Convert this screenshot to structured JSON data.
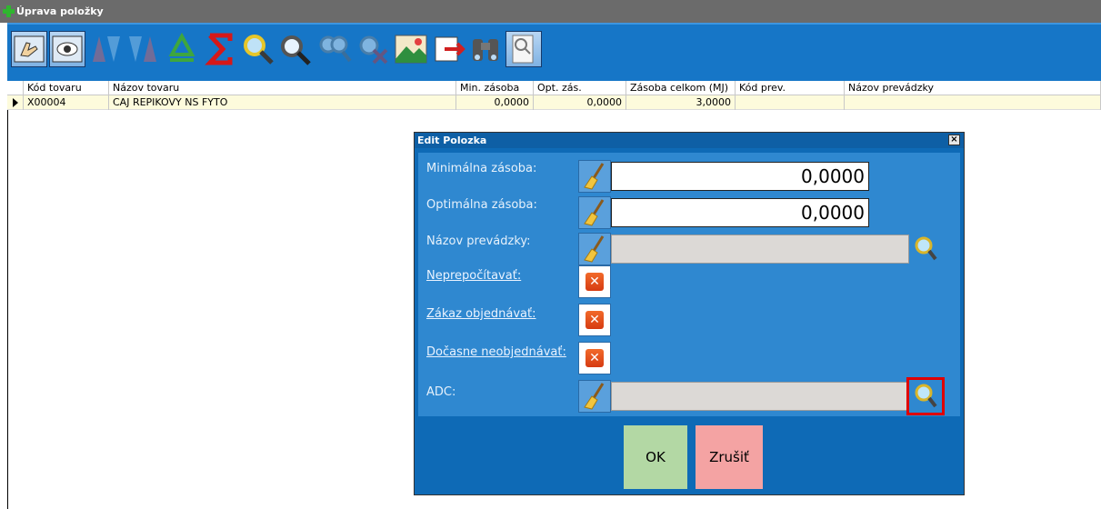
{
  "window": {
    "title": "Úprava položky"
  },
  "toolbar": {
    "buttons": [
      {
        "icon": "edit-hand-icon"
      },
      {
        "icon": "view-eye-icon"
      },
      {
        "icon": "sort-asc-icon"
      },
      {
        "icon": "sort-desc-icon"
      },
      {
        "icon": "recycle-icon"
      },
      {
        "icon": "sum-icon"
      },
      {
        "icon": "search-icon"
      },
      {
        "icon": "search-zoom-icon"
      },
      {
        "icon": "multi-search-icon"
      },
      {
        "icon": "cancel-search-icon"
      },
      {
        "icon": "image-icon"
      },
      {
        "icon": "export-icon"
      },
      {
        "icon": "binoculars-icon"
      },
      {
        "icon": "document-search-icon"
      }
    ]
  },
  "grid": {
    "columns": [
      "Kód tovaru",
      "Názov tovaru",
      "Min. zásoba",
      "Opt. zás.",
      "Zásoba celkom (MJ)",
      "Kód prev.",
      "Názov prevádzky"
    ],
    "rows": [
      {
        "kod": "X00004",
        "nazov": "CAJ REPIKOVY NS  FYTO",
        "min": "0,0000",
        "opt": "0,0000",
        "zasoba": "3,0000",
        "kod_prev": "",
        "nazov_prev": ""
      }
    ]
  },
  "dialog": {
    "title": "Edit Polozka",
    "close_label": "×",
    "fields": {
      "min_label": "Minimálna zásoba:",
      "min_value": "0,0000",
      "opt_label": "Optimálna zásoba:",
      "opt_value": "0,0000",
      "prev_label": "Názov prevádzky:",
      "prev_value": "",
      "neprep_label": "Neprepočítavať:",
      "zakaz_label": "Zákaz objednávať:",
      "docasne_label": "Dočasne neobjednávať:",
      "adc_label": "ADC:",
      "adc_value": ""
    },
    "checkbox_glyph": "✕",
    "ok_label": "OK",
    "cancel_label": "Zrušiť"
  },
  "colors": {
    "toolbar": "#1676c7",
    "dialog_body": "#2f88d0",
    "ok": "#b3d8a4",
    "cancel": "#f4a3a3",
    "highlight": "#e00000"
  }
}
